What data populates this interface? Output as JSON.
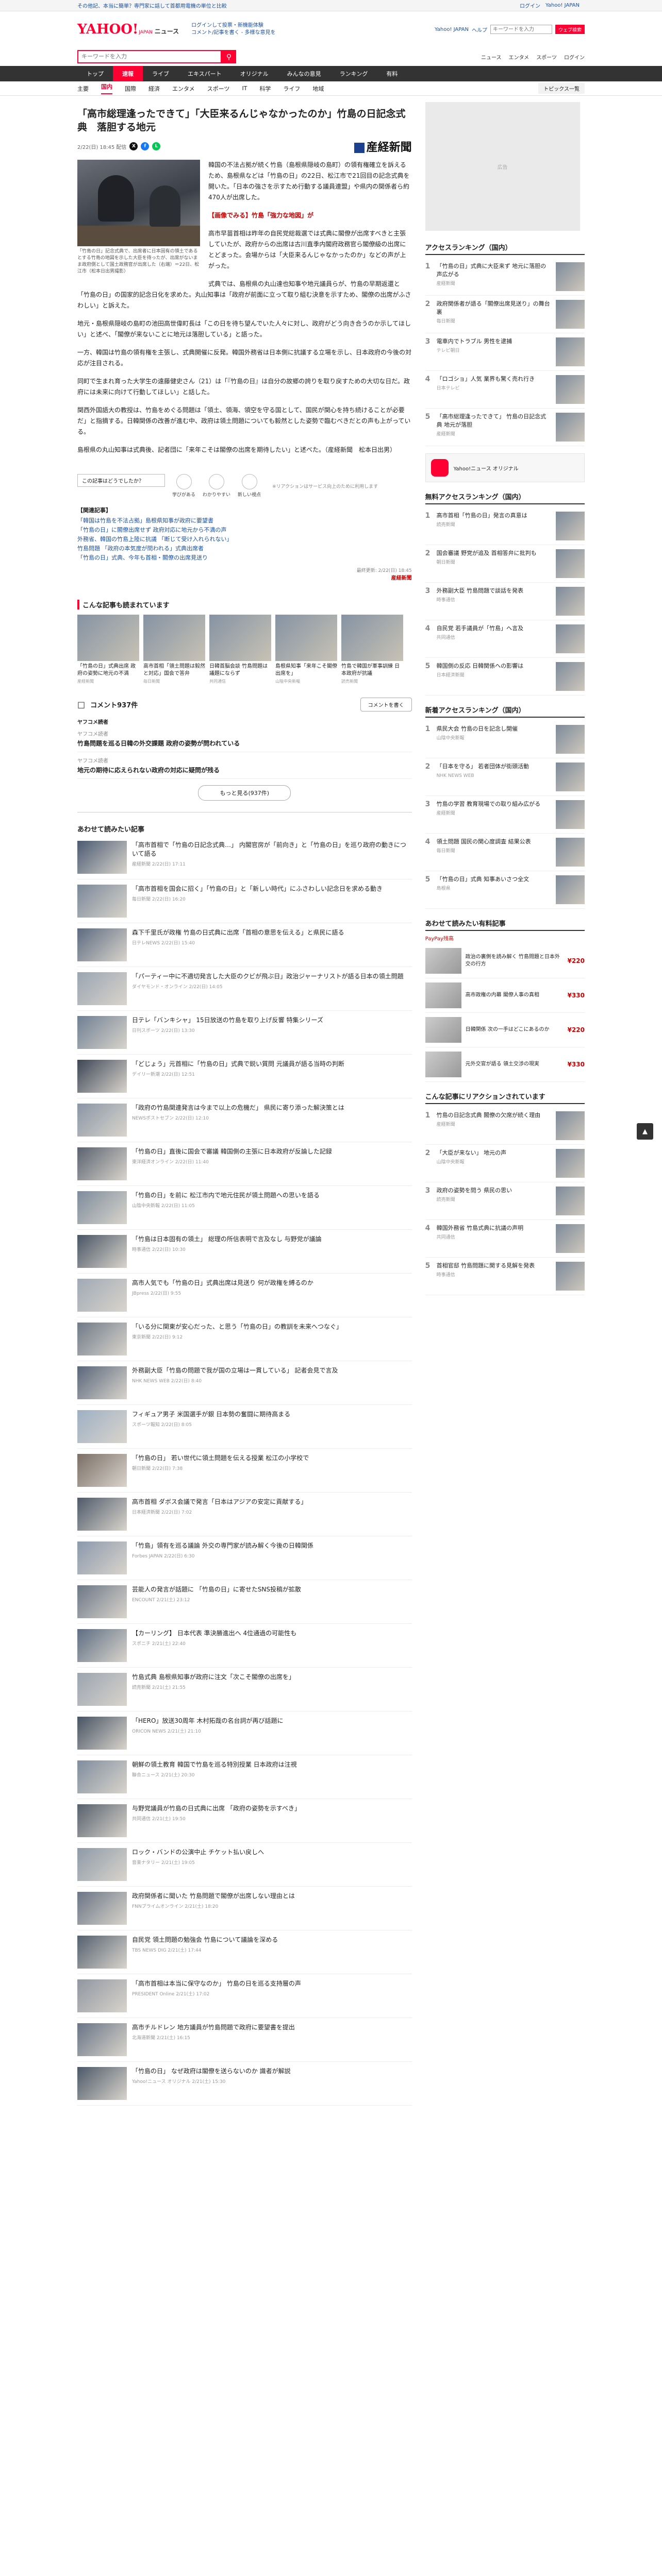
{
  "util_bar": {
    "links": [
      "その他記、本当に簡単？専門家に話して首都用電機の単位と比較",
      "ログイン",
      "Yahoo! JAPAN"
    ]
  },
  "header": {
    "logo": "YAHOO!",
    "logo_sub": "JAPAN",
    "service": "ニュース",
    "links": [
      "ログインして投票・新機能体験",
      "コメント/記事を書く - 多様な意見を"
    ],
    "right_links": [
      "Yahoo! JAPAN",
      "ヘルプ"
    ],
    "search_placeholder": "キーワードを入力",
    "search_button": "ウェブ検索"
  },
  "searchrow": {
    "placeholder": "キーワードを入力",
    "right": [
      "ニュース",
      "エンタメ",
      "スポーツ",
      "ログイン"
    ]
  },
  "tabs": [
    "トップ",
    "速報",
    "ライブ",
    "エキスパート",
    "オリジナル",
    "みんなの意見",
    "ランキング",
    "有料"
  ],
  "subtabs": [
    "主要",
    "国内",
    "国際",
    "経済",
    "エンタメ",
    "スポーツ",
    "IT",
    "科学",
    "ライフ",
    "地域"
  ],
  "subtabs_active": 1,
  "topics_button": "トピックス一覧",
  "article": {
    "title": "「高市総理逢ったできて」「大臣来るんじゃなかったのか」竹島の日記念式典　落胆する地元",
    "meta": "2/22(日) 18:45 配信",
    "publisher": "産経新聞",
    "caption": "「竹島の日」記念式典で、出席者に日本固有の領土であるとする竹島の地図を示した大臣を待ったが、出席がないまま政府側として国土政務官が出席した（右端）＝22日、松江市（松本日出男撮影）",
    "paragraphs": [
      "韓国の不法占拠が続く竹島（島根県隠岐の島町）の領有権確立を訴えるため、島根県などは「竹島の日」の22日、松江市で21回目の記念式典を開いた。「日本の強さを示すため行動する議員連盟」や県内の関係者ら約470人が出席した。",
      "【画像でみる】竹島「強力な地図」が",
      "高市早苗首相は昨年の自民党総裁選では式典に閣僚が出席すべきと主張していたが、政府からの出席は古川直季内閣府政務官ら閣僚級の出席にとどまった。会場からは「大臣来るんじゃなかったのか」などの声が上がった。",
      "式典では、島根県の丸山達也知事や地元議員らが、竹島の早期返還と「竹島の日」の国家的記念日化を求めた。丸山知事は「政府が前面に立って取り組む決意を示すため、閣僚の出席がふさわしい」と訴えた。",
      "地元・島根県隠岐の島町の池田高世偉町長は「この日を待ち望んでいた人々に対し、政府がどう向き合うのか示してほしい」と述べ、「閣僚が来ないことに地元は落胆している」と語った。",
      "一方、韓国は竹島の領有権を主張し、式典開催に反発。韓国外務省は日本側に抗議する立場を示し、日本政府の今後の対応が注目される。",
      "同町で生まれ育った大学生の遠藤健史さん（21）は「『竹島の日』は自分の故郷の誇りを取り戻すための大切な日だ。政府には未来に向けて行動してほしい」と話した。",
      "関西外国語大の教授は、竹島をめぐる問題は「領土、領海、領空を守る国として、国民が関心を持ち続けることが必要だ」と指摘する。日韓関係の改善が進む中、政府は領土問題についても毅然とした姿勢で臨むべきだとの声も上がっている。",
      "島根県の丸山知事は式典後、記者団に「来年こそは閣僚の出席を期待したい」と述べた。（産経新聞　松本日出男）"
    ],
    "reactions_box": "この記事はどうでしたか？",
    "reactions": [
      "学びがある",
      "わかりやすい",
      "新しい視点"
    ],
    "reactions_note": "※リアクションはサービス向上のために利用します",
    "related_heading": "【関連記事】",
    "related": [
      "「韓国は竹島を不法占拠」島根県知事が政府に要望書",
      "「竹島の日」に閣僚出席せず 政府対応に地元から不満の声",
      "外務省、韓国の竹島上陸に抗議 「断じて受け入れられない」",
      "竹島問題 「政府の本気度が問われる」式典出席者",
      "「竹島の日」式典、今年も首相・閣僚の出席見送り"
    ],
    "source_line": "最終更新: 2/22(日) 18:45",
    "source_more": "産経新聞"
  },
  "recommended": {
    "heading": "こんな記事も読まれています",
    "items": [
      {
        "t": "「竹島の日」式典出席 政府の姿勢に地元の不満",
        "s": "産経新聞"
      },
      {
        "t": "高市首相「領土問題は毅然と対応」国会で答弁",
        "s": "毎日新聞"
      },
      {
        "t": "日韓首脳会談 竹島問題は議題にならず",
        "s": "共同通信"
      },
      {
        "t": "島根県知事「来年こそ閣僚出席を」",
        "s": "山陰中央新報"
      },
      {
        "t": "竹島で韓国が軍事訓練 日本政府が抗議",
        "s": "読売新聞"
      }
    ]
  },
  "comments": {
    "title": "コメント937件",
    "button": "コメントを書く",
    "ranking_label": "ヤフコメ読者",
    "list": [
      {
        "u": "ヤフコメ読者",
        "b": "竹島問題を巡る日韓の外交課題 政府の姿勢が問われている"
      },
      {
        "u": "ヤフコメ読者",
        "b": "地元の期待に応えられない政府の対応に疑問が残る"
      }
    ],
    "more": "もっと見る(937件)"
  },
  "feed": {
    "heading": "あわせて読みたい記事",
    "items": [
      {
        "t": "「高市首相で「竹島の日記念式典…」 内閣官房が「前向き」と「竹島の日」を巡り政府の動きについて語る",
        "s": "産経新聞 2/22(日) 17:11",
        "c": "#4a5a72"
      },
      {
        "t": "「高市首相を国会に招く」「竹島の日」と「新しい時代」にふさわしい記念日を求める動き",
        "s": "毎日新聞 2/22(日) 16:20",
        "c": "#7a8899"
      },
      {
        "t": "森下千里氏が政権 竹島の日式典に出席「首相の意思を伝える」と県民に語る",
        "s": "日テレNEWS 2/22(日) 15:40",
        "c": "#5c6b80"
      },
      {
        "t": "「パーティー中に不適切発言した大臣のクビが飛ぶ日」政治ジャーナリストが語る日本の領土問題",
        "s": "ダイヤモンド・オンライン 2/22(日) 14:05",
        "c": "#9aa5b2"
      },
      {
        "t": "日テレ「バンキシャ」 15日放送の竹島を取り上げ反響 特集シリーズ",
        "s": "日刊スポーツ 2/22(日) 13:30",
        "c": "#6e7f93"
      },
      {
        "t": "「どじょう」元首相に「竹島の日」式典で鋭い質問 元議員が語る当時の判断",
        "s": "デイリー新潮 2/22(日) 12:51",
        "c": "#3d4656"
      },
      {
        "t": "「政府の竹島関連発言は今まで以上の危機だ」 県民に寄り添った解決策とは",
        "s": "NEWSポストセブン 2/22(日) 12:10",
        "c": "#8a96a6"
      },
      {
        "t": "「竹島の日」直後に国会で審議 韓国側の主張に日本政府が反論した記録",
        "s": "東洋経済オンライン 2/22(日) 11:40",
        "c": "#5a6270"
      },
      {
        "t": "「竹島の日」を前に 松江市内で地元住民が領土問題への思いを語る",
        "s": "山陰中央新報 2/22(日) 11:05",
        "c": "#7d8c9c"
      },
      {
        "t": "「竹島は日本固有の領土」 総理の所信表明で言及なし 与野党が議論",
        "s": "時事通信 2/22(日) 10:30",
        "c": "#495565"
      },
      {
        "t": "高市人気でも「竹島の日」式典出席は見送り 何が政権を縛るのか",
        "s": "JBpress 2/22(日) 9:55",
        "c": "#a0a9b5"
      },
      {
        "t": "「いる分に関東が安心だった、と思う「竹島の日」の教訓を未来へつなぐ」",
        "s": "東京新聞 2/22(日) 9:12",
        "c": "#6f7a88"
      },
      {
        "t": "外務副大臣「竹島の問題で我が国の立場は一貫している」 記者会見で言及",
        "s": "NHK NEWS WEB 2/22(日) 8:40",
        "c": "#58667a"
      },
      {
        "t": "フィギュア男子 米国選手が銀 日本勢の奮闘に期待高まる",
        "s": "スポーツ報知 2/22(日) 8:05",
        "c": "#9eb0c4"
      },
      {
        "t": "「竹島の日」 若い世代に領土問題を伝える授業 松江の小学校で",
        "s": "朝日新聞 2/22(日) 7:38",
        "c": "#7a6f66"
      },
      {
        "t": "高市首相 ダボス会議で発言「日本はアジアの安定に貢献する」",
        "s": "日本経済新聞 2/22(日) 7:02",
        "c": "#4e5a6a"
      },
      {
        "t": "「竹島」領有を巡る議論 外交の専門家が読み解く今後の日韓関係",
        "s": "Forbes JAPAN 2/22(日) 6:30",
        "c": "#8b99ac"
      },
      {
        "t": "芸能人の発言が話題に 「竹島の日」に寄せたSNS投稿が拡散",
        "s": "ENCOUNT 2/21(土) 23:12",
        "c": "#6c7787"
      },
      {
        "t": "【カーリング】 日本代表 準決勝進出へ 4位通過の可能性も",
        "s": "スポニチ 2/21(土) 22:40",
        "c": "#5d6e83"
      },
      {
        "t": "竹島式典 島根県知事が政府に注文「次こそ閣僚の出席を」",
        "s": "読売新聞 2/21(土) 21:55",
        "c": "#9ba4b0"
      },
      {
        "t": "「HERO」放送30周年 木村拓哉の名台詞が再び話題に",
        "s": "ORICON NEWS 2/21(土) 21:10",
        "c": "#475363"
      },
      {
        "t": "朝鮮の領土教育 韓国で竹島を巡る特別授業 日本政府は注視",
        "s": "聯合ニュース 2/21(土) 20:30",
        "c": "#7f8d9e"
      },
      {
        "t": "与野党議員が竹島の日式典に出席 「政府の姿勢を示すべき」",
        "s": "共同通信 2/21(土) 19:50",
        "c": "#56606d"
      },
      {
        "t": "ロック・バンドの公演中止 チケット払い戻しへ",
        "s": "音楽ナタリー 2/21(土) 19:05",
        "c": "#8e9aa8"
      },
      {
        "t": "政府関係者に聞いた 竹島問題で閣僚が出席しない理由とは",
        "s": "FNNプライムオンライン 2/21(土) 18:20",
        "c": "#6a7585"
      },
      {
        "t": "自民党 領土問題の勉強会 竹島について議論を深める",
        "s": "TBS NEWS DIG 2/21(土) 17:44",
        "c": "#53606f"
      },
      {
        "t": "「高市首相は本当に保守なのか」 竹島の日を巡る支持層の声",
        "s": "PRESIDENT Online 2/21(土) 17:02",
        "c": "#9096a0"
      },
      {
        "t": "高市チルドレン 地方議員が竹島問題で政府に要望書を提出",
        "s": "北海道新聞 2/21(土) 16:15",
        "c": "#687486"
      },
      {
        "t": "「竹島の日」 なぜ政府は閣僚を送らないのか 識者が解説",
        "s": "Yahoo!ニュース オリジナル 2/21(土) 15:30",
        "c": "#4b5868"
      }
    ]
  },
  "sidebar": {
    "ad_label": "広告",
    "access_heading": "アクセスランキング（国内）",
    "access": [
      {
        "t": "「竹島の日」式典に大臣来ず 地元に落胆の声広がる",
        "s": "産経新聞"
      },
      {
        "t": "政府関係者が語る「閣僚出席見送り」の舞台裏",
        "s": "毎日新聞"
      },
      {
        "t": "電車内でトラブル 男性を逮捕",
        "s": "テレビ朝日"
      },
      {
        "t": "「ロゴショ」人気 業界も驚く売れ行き",
        "s": "日本テレビ"
      },
      {
        "t": "「高市総理逢ったできて」 竹島の日記念式典 地元が落胆",
        "s": "産経新聞"
      }
    ],
    "promo": "Yahoo!ニュース オリジナル",
    "comment_heading": "無料アクセスランキング（国内）",
    "comment_rank": [
      {
        "t": "高市首相「竹島の日」発言の真意は",
        "s": "読売新聞"
      },
      {
        "t": "国会審議 野党が追及 首相答弁に批判も",
        "s": "朝日新聞"
      },
      {
        "t": "外務副大臣 竹島問題で談話を発表",
        "s": "時事通信"
      },
      {
        "t": "自民党 若手議員が「竹島」へ言及",
        "s": "共同通信"
      },
      {
        "t": "韓国側の反応 日韓関係への影響は",
        "s": "日本経済新聞"
      }
    ],
    "new_heading": "新着アクセスランキング（国内）",
    "new_rank": [
      {
        "t": "県民大会 竹島の日を記念し開催",
        "s": "山陰中央新報"
      },
      {
        "t": "「日本を守る」 若者団体が街頭活動",
        "s": "NHK NEWS WEB"
      },
      {
        "t": "竹島の学習 教育現場での取り組み広がる",
        "s": "産経新聞"
      },
      {
        "t": "領土問題 国民の関心度調査 結果公表",
        "s": "毎日新聞"
      },
      {
        "t": "「竹島の日」式典 知事あいさつ全文",
        "s": "島根県"
      }
    ],
    "paypay_heading": "あわせて読みたい有料記事",
    "paypay_label": "PayPay残高",
    "paypay": [
      {
        "t": "政治の裏側を読み解く 竹島問題と日本外交の行方",
        "p": "¥220"
      },
      {
        "t": "高市政権の内幕 閣僚人事の真相",
        "p": "¥330"
      },
      {
        "t": "日韓関係 次の一手はどこにあるのか",
        "p": "¥220"
      },
      {
        "t": "元外交官が語る 領土交渉の現実",
        "p": "¥330"
      }
    ],
    "comment2_heading": "こんな記事にリアクションされています",
    "comment2": [
      {
        "t": "竹島の日記念式典 閣僚の欠席が続く理由",
        "s": "産経新聞"
      },
      {
        "t": "「大臣が来ない」 地元の声",
        "s": "山陰中央新報"
      },
      {
        "t": "政府の姿勢を問う 県民の思い",
        "s": "読売新聞"
      },
      {
        "t": "韓国外務省 竹島式典に抗議の声明",
        "s": "共同通信"
      },
      {
        "t": "首相官邸 竹島問題に関する見解を発表",
        "s": "時事通信"
      }
    ]
  },
  "colors": {
    "accent": "#ff0033",
    "link": "#1a4fa3"
  },
  "pagetop": "▲"
}
